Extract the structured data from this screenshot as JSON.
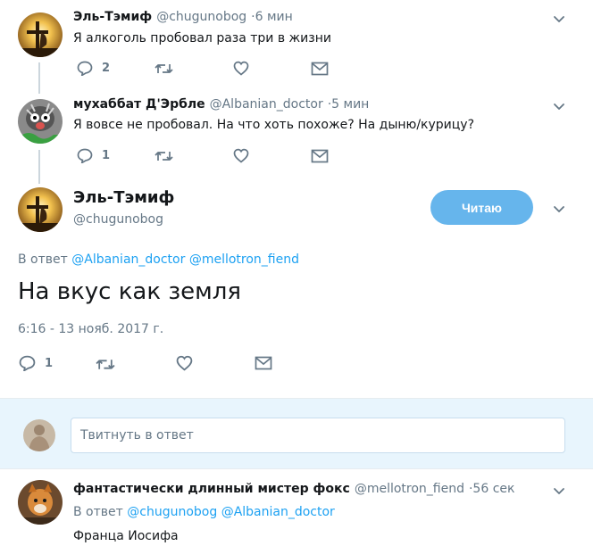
{
  "tweet1": {
    "name": "Эль-Тэмиф",
    "handle": "@chugunobog",
    "time": "·6 мин",
    "text": "Я алкоголь пробовал раза три в жизни",
    "replies": "2"
  },
  "tweet2": {
    "name": "мухаббат Д'Эрбле",
    "handle": "@Albanian_doctor",
    "time": "·5 мин",
    "text": "Я вовсе не пробовал. На что хоть похоже? На дыню/курицу?",
    "replies": "1"
  },
  "main_tweet": {
    "name": "Эль-Тэмиф",
    "handle": "@chugunobog",
    "follow_label": "Читаю",
    "reply_prefix": "В ответ",
    "reply_to_1": "@Albanian_doctor",
    "reply_to_2": "@mellotron_fiend",
    "text": "На вкус как земля",
    "timestamp": "6:16 - 13 нояб. 2017 г.",
    "replies": "1"
  },
  "reply_box": {
    "placeholder": "Твитнуть в ответ"
  },
  "tweet3": {
    "name": "фантастически длинный мистер фокс",
    "handle": "@mellotron_fiend",
    "time": "·56 сек",
    "reply_prefix": "В ответ",
    "reply_to_1": "@chugunobog",
    "reply_to_2": "@Albanian_doctor",
    "text": "Франца Иосифа"
  },
  "icons": {
    "reply": "reply-icon",
    "retweet": "retweet-icon",
    "like": "heart-icon",
    "dm": "envelope-icon",
    "more": "chevron-down-icon"
  },
  "colors": {
    "accent": "#1da1f2",
    "follow_button": "#66b5ec",
    "muted": "#657786",
    "divider": "#e6ecf0",
    "thread_line": "#ccd6dd"
  }
}
